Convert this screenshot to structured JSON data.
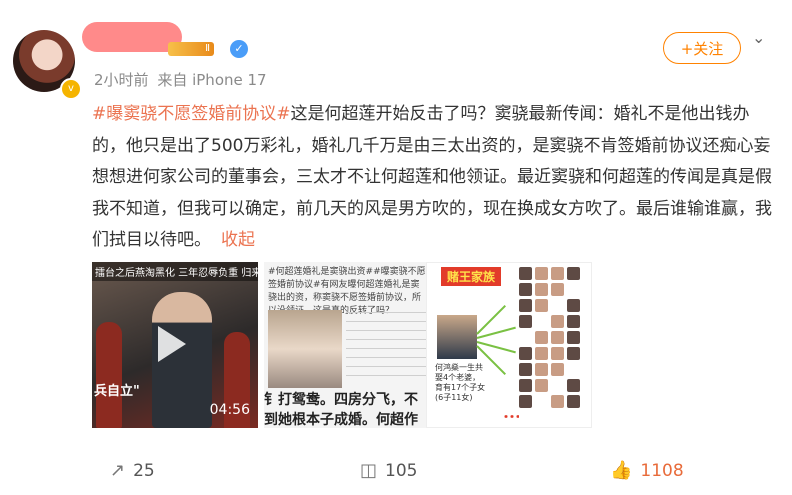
{
  "header": {
    "post_time": "2小时前",
    "source": "来自 iPhone 17",
    "follow_label": "+关注",
    "level_badge": "Ⅱ",
    "verified_glyph": "✓",
    "avatar_badge": "v",
    "menu_icon": "chevron-down-icon"
  },
  "content": {
    "hashtag": "#曝窦骁不愿签婚前协议#",
    "body": "这是何超莲开始反击了吗？窦骁最新传闻：婚礼不是他出钱办的，他只是出了500万彩礼，婚礼几千万是由三太出资的，是窦骁不肯签婚前协议还痴心妄想想进何家公司的董事会，三太才不让何超莲和他领证。最近窦骁和何超莲的传闻是真是假我不知道，但我可以确定，前几天的风是男方吹的，现在换成女方吹了。最后谁输谁赢，我们拭目以待吧。",
    "collapse_label": "收起"
  },
  "media": {
    "video": {
      "caption": "擂台之后燕淘黑化 三年忍辱负重 归来血洗仇",
      "side_text": "兵自立\"",
      "duration": "04:56"
    },
    "article": {
      "text": "#何超莲婚礼是窦骁出资##曝窦骁不愿签婚前协议#有网友曝何超莲婚礼是窦骁出的资，称窦骁不愿签婚前协议，所以没领证，这是真的反转了吗？",
      "big_text": "钅打鸳鸯。四房分飞，不到她根本子成婚。何超作为二房的他"
    },
    "family": {
      "title": "赌王家族",
      "note": "何鸿燊一生共娶4个老婆，育有17个子女(6子11女)"
    }
  },
  "actions": {
    "repost_icon": "share-icon",
    "repost_count": "25",
    "comment_icon": "comment-icon",
    "comment_count": "105",
    "like_icon": "thumbs-up-icon",
    "like_count": "1108"
  },
  "colors": {
    "accent": "#ff8200",
    "hashtag": "#eb7350",
    "like": "#e86b3a"
  }
}
